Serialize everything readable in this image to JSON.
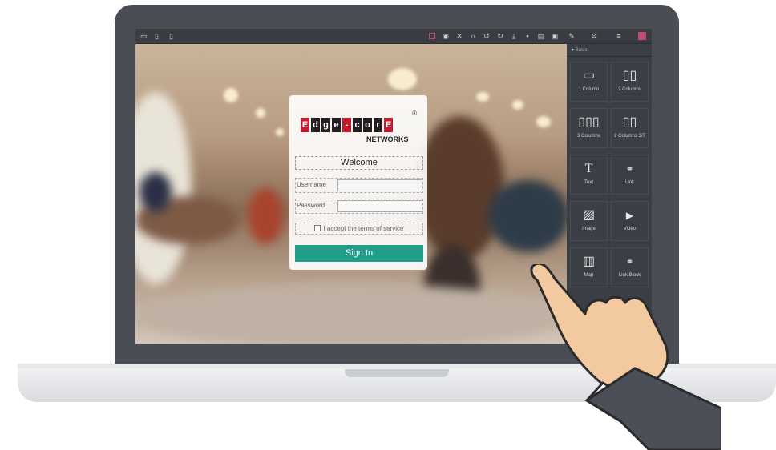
{
  "toolbar": {
    "devices": [
      "desktop-icon",
      "tablet-icon",
      "mobile-icon"
    ],
    "actions": [
      "select-icon",
      "preview-icon",
      "fullscreen-icon",
      "code-icon",
      "undo-icon",
      "redo-icon",
      "import-icon",
      "delete-icon",
      "export-icon",
      "save-icon",
      "style-manager-icon",
      "settings-icon",
      "layer-manager-icon",
      "blocks-icon"
    ],
    "accent": "#c34c72"
  },
  "login": {
    "logo_letters": [
      "E",
      "d",
      "g",
      "e",
      "-",
      "c",
      "o",
      "r",
      "E"
    ],
    "logo_sub": "NETWORKS",
    "welcome": "Welcome",
    "username_label": "Username",
    "password_label": "Password",
    "terms": "I accept the terms of service",
    "button": "Sign In",
    "button_color": "#1f9f8a"
  },
  "panel": {
    "section": "▾ Basic",
    "blocks": [
      {
        "label": "1 Column",
        "icon": "column-icon"
      },
      {
        "label": "2 Columns",
        "icon": "two-columns-icon"
      },
      {
        "label": "3 Columns",
        "icon": "three-columns-icon"
      },
      {
        "label": "2 Columns 3/7",
        "icon": "two-columns-37-icon"
      },
      {
        "label": "Text",
        "icon": "text-icon"
      },
      {
        "label": "Link",
        "icon": "link-icon"
      },
      {
        "label": "Image",
        "icon": "image-icon"
      },
      {
        "label": "Video",
        "icon": "video-icon"
      },
      {
        "label": "Map",
        "icon": "map-icon"
      },
      {
        "label": "Link Block",
        "icon": "link-block-icon"
      }
    ]
  }
}
